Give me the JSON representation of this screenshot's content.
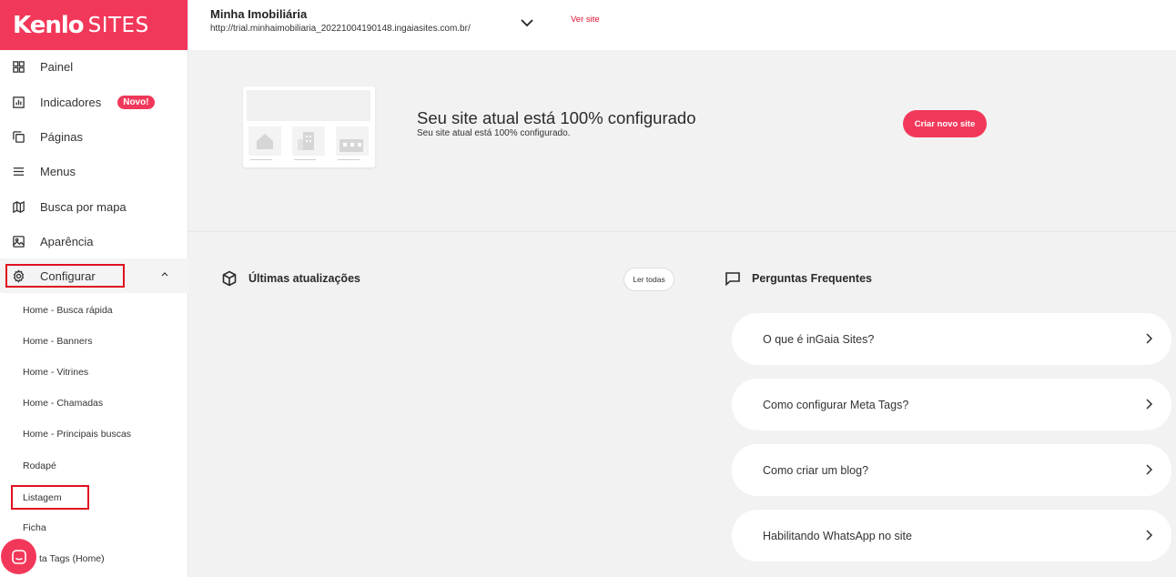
{
  "brand": {
    "logo": "Kenlo",
    "logo_sub": "SITES"
  },
  "sidebar": {
    "items": [
      {
        "label": "Painel",
        "icon": "grid-icon"
      },
      {
        "label": "Indicadores",
        "icon": "bar-chart-icon",
        "badge": "Novo!"
      },
      {
        "label": "Páginas",
        "icon": "pages-icon"
      },
      {
        "label": "Menus",
        "icon": "menu-icon"
      },
      {
        "label": "Busca por mapa",
        "icon": "map-icon"
      },
      {
        "label": "Aparência",
        "icon": "image-icon"
      },
      {
        "label": "Configurar",
        "icon": "gear-icon",
        "expanded": true
      }
    ],
    "subitems": [
      "Home - Busca rápida",
      "Home - Banners",
      "Home - Vitrines",
      "Home - Chamadas",
      "Home - Principais buscas",
      "Rodapé",
      "Listagem",
      "Ficha",
      "ta Tags (Home)"
    ]
  },
  "header": {
    "site_name": "Minha Imobiliária",
    "site_url": "http://trial.minhaimobiliaria_20221004190148.ingaiasites.com.br/",
    "view_site": "Ver site"
  },
  "hero": {
    "title": "Seu site atual está 100% configurado",
    "subtitle": "Seu site atual está 100% configurado.",
    "cta": "Criar novo site"
  },
  "updates": {
    "title": "Últimas atualizações",
    "see_all": "Ler todas"
  },
  "faq": {
    "title": "Perguntas Frequentes",
    "items": [
      "O que é inGaia Sites?",
      "Como configurar Meta Tags?",
      "Como criar um blog?",
      "Habilitando WhatsApp no site"
    ]
  },
  "colors": {
    "brand": "#f2385a",
    "highlight": "#e0101f",
    "link": "#e0142f"
  }
}
